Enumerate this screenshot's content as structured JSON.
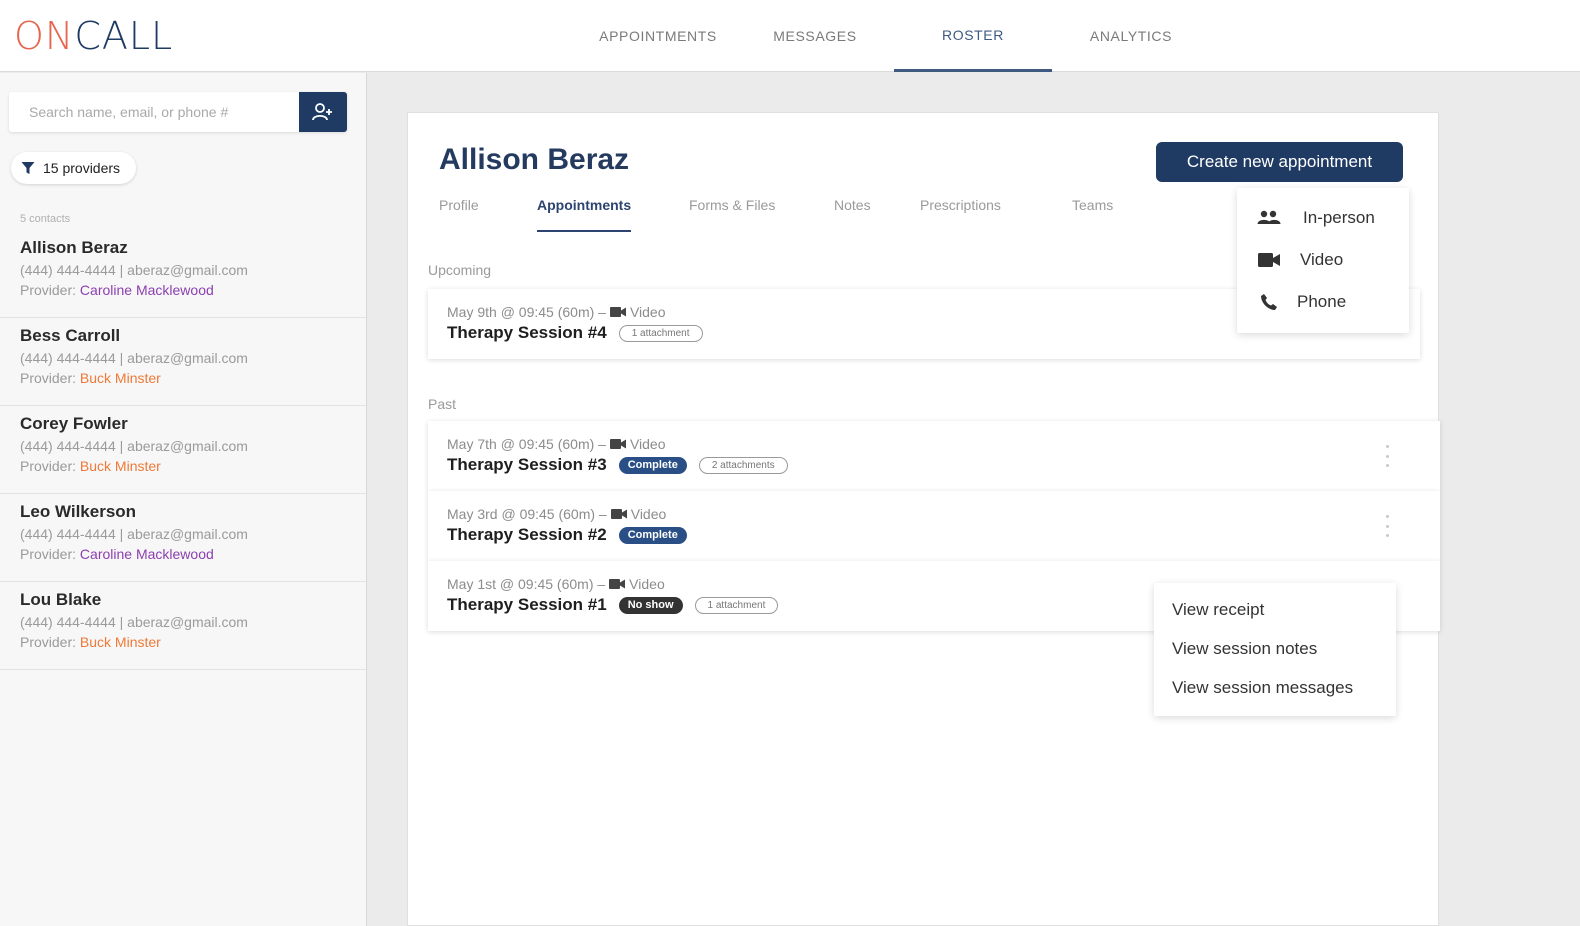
{
  "brand": {
    "logo_on": "ON",
    "logo_call": "CALL"
  },
  "nav": {
    "items": [
      "APPOINTMENTS",
      "MESSAGES",
      "ROSTER",
      "ANALYTICS"
    ],
    "active": "ROSTER"
  },
  "sidebar": {
    "search_placeholder": "Search name, email, or phone #",
    "filter_label": "15 providers",
    "contacts_count": "5 contacts",
    "contacts": [
      {
        "name": "Allison Beraz",
        "details": "(444) 444-4444 | aberaz@gmail.com",
        "provider_label": "Provider:",
        "provider": "Caroline Macklewood"
      },
      {
        "name": "Bess Carroll",
        "details": "(444) 444-4444 | aberaz@gmail.com",
        "provider_label": "Provider:",
        "provider": "Buck Minster"
      },
      {
        "name": "Corey Fowler",
        "details": "(444) 444-4444 | aberaz@gmail.com",
        "provider_label": "Provider:",
        "provider": "Buck Minster"
      },
      {
        "name": "Leo Wilkerson",
        "details": "(444) 444-4444 | aberaz@gmail.com",
        "provider_label": "Provider:",
        "provider": "Caroline Macklewood"
      },
      {
        "name": "Lou Blake",
        "details": "(444) 444-4444 | aberaz@gmail.com",
        "provider_label": "Provider:",
        "provider": "Buck Minster"
      }
    ]
  },
  "main": {
    "client_name": "Allison Beraz",
    "create_button": "Create new appointment",
    "tabs": [
      "Profile",
      "Appointments",
      "Forms & Files",
      "Notes",
      "Prescriptions",
      "Teams"
    ],
    "active_tab": "Appointments",
    "upcoming_label": "Upcoming",
    "past_label": "Past",
    "upcoming": [
      {
        "meta": "May 9th @ 09:45 (60m) –",
        "mode": "Video",
        "title": "Therapy Session #4",
        "status": "",
        "attachments": "1 attachment"
      }
    ],
    "past": [
      {
        "meta": "May 7th @ 09:45 (60m) –",
        "mode": "Video",
        "title": "Therapy Session #3",
        "status": "Complete",
        "attachments": "2 attachments"
      },
      {
        "meta": "May 3rd @ 09:45 (60m) –",
        "mode": "Video",
        "title": "Therapy Session #2",
        "status": "Complete",
        "attachments": ""
      },
      {
        "meta": "May 1st @ 09:45 (60m) –",
        "mode": "Video",
        "title": "Therapy Session #1",
        "status": "No show",
        "attachments": "1 attachment"
      }
    ]
  },
  "appointment_type_menu": {
    "items": [
      "In-person",
      "Video",
      "Phone"
    ]
  },
  "session_menu": {
    "items": [
      "View receipt",
      "View session notes",
      "View session messages"
    ]
  },
  "colors": {
    "brand_navy": "#1f3b63",
    "logo_coral": "#e5654e",
    "provider_purple": "#8c3fb0",
    "provider_orange": "#ef7a3a"
  }
}
